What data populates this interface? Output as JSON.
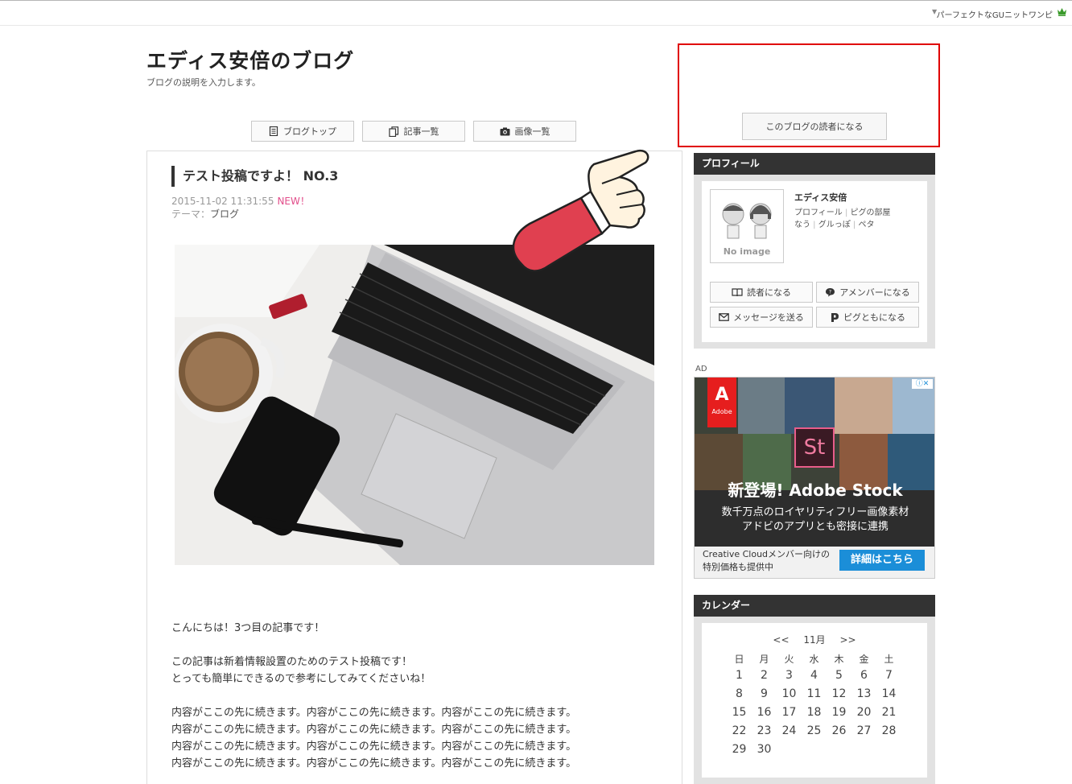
{
  "topbar": {
    "link": "パーフェクトなGUニットワンピ"
  },
  "blog": {
    "title": "エディス安倍のブログ",
    "description": "ブログの説明を入力します。"
  },
  "nav": {
    "top": "ブログトップ",
    "articles": "記事一覧",
    "images": "画像一覧"
  },
  "reader_button": "このブログの読者になる",
  "post": {
    "title": "テスト投稿ですよ！ NO.3",
    "date": "2015-11-02 11:31:55",
    "new_badge": "NEW！",
    "theme_label": "テーマ：",
    "theme": "ブログ",
    "body": [
      "こんにちは！3つ目の記事です！",
      "この記事は新着情報設置のためのテスト投稿です！",
      "とっても簡単にできるので参考にしてみてくださいね！",
      "内容がここの先に続きます。内容がここの先に続きます。内容がここの先に続きます。",
      "内容がここの先に続きます。内容がここの先に続きます。内容がここの先に続きます。",
      "内容がここの先に続きます。内容がここの先に続きます。内容がここの先に続きます。",
      "内容がここの先に続きます。内容がここの先に続きます。内容がここの先に続きます。"
    ]
  },
  "profile": {
    "heading": "プロフィール",
    "no_image": "No image",
    "name": "エディス安倍",
    "link_profile": "プロフィール",
    "link_room": "ピグの部屋",
    "link_now": "なう",
    "link_gurume": "グルっぽ",
    "link_peta": "ペタ",
    "btn_reader": "読者になる",
    "btn_amember": "アメンバーになる",
    "btn_message": "メッセージを送る",
    "btn_pigg": "ピグともになる"
  },
  "ad": {
    "label": "AD",
    "brand": "Adobe",
    "product_icon": "St",
    "headline": "新登場! Adobe Stock",
    "sub1": "数千万点のロイヤリティフリー画像素材",
    "sub2": "アドビのアプリとも密接に連携",
    "foot1": "Creative Cloudメンバー向けの",
    "foot2": "特別価格も提供中",
    "cta": "詳細はこちら"
  },
  "calendar": {
    "heading": "カレンダー",
    "prev": "<<",
    "month": "11月",
    "next": ">>",
    "weekdays": [
      "日",
      "月",
      "火",
      "水",
      "木",
      "金",
      "土"
    ],
    "weeks": [
      [
        "1",
        "2",
        "3",
        "4",
        "5",
        "6",
        "7"
      ],
      [
        "8",
        "9",
        "10",
        "11",
        "12",
        "13",
        "14"
      ],
      [
        "15",
        "16",
        "17",
        "18",
        "19",
        "20",
        "21"
      ],
      [
        "22",
        "23",
        "24",
        "25",
        "26",
        "27",
        "28"
      ],
      [
        "29",
        "30",
        "",
        "",
        "",
        "",
        ""
      ]
    ]
  },
  "colors": {
    "accent_red": "#e00000",
    "new_pink": "#e24d8a",
    "header_dark": "#333333",
    "ad_blue": "#1b8ed8"
  }
}
